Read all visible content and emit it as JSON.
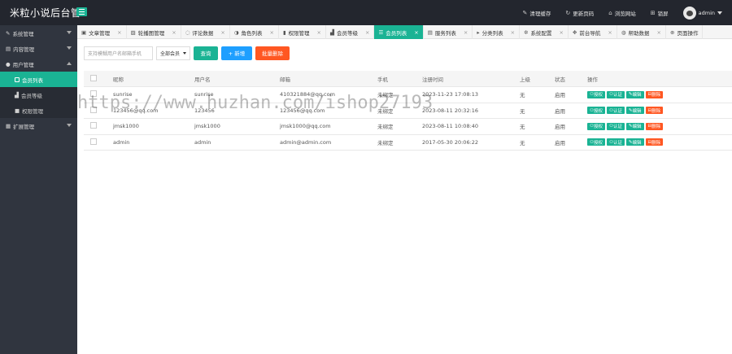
{
  "app": {
    "title": "米粒小说后台管"
  },
  "topnav": [
    {
      "icon": "broom-icon",
      "glyph": "✎",
      "label": "清理缓存"
    },
    {
      "icon": "refresh-icon",
      "glyph": "↻",
      "label": "更新页码"
    },
    {
      "icon": "home-icon",
      "glyph": "⌂",
      "label": "浏览网站"
    },
    {
      "icon": "lock-icon",
      "glyph": "⊞",
      "label": "锁屏"
    },
    {
      "label": "admin"
    }
  ],
  "sidebar": {
    "items": [
      {
        "label": "系统管理"
      },
      {
        "label": "内容管理"
      },
      {
        "label": "用户管理"
      }
    ],
    "subs": [
      {
        "label": "会员列表"
      },
      {
        "label": "会员等级"
      },
      {
        "label": "权限管理"
      }
    ],
    "extra": {
      "label": "扩展管理"
    }
  },
  "tabs": [
    {
      "label": "文章管理"
    },
    {
      "label": "轮播图管理"
    },
    {
      "label": "评论数据"
    },
    {
      "label": "角色列表"
    },
    {
      "label": "权限管理"
    },
    {
      "label": "会员等级"
    },
    {
      "label": "会员列表"
    },
    {
      "label": "服务列表"
    },
    {
      "label": "分类列表"
    },
    {
      "label": "系统配置"
    },
    {
      "label": "前台导航"
    },
    {
      "label": "帮助数据"
    },
    {
      "label": "页面操作"
    }
  ],
  "toolbar": {
    "search_placeholder": "支持模糊用户名邮箱手机",
    "select_value": "全部会员",
    "query_label": "查询",
    "add_label": "+ 新增",
    "batch_delete_label": "批量删除"
  },
  "table": {
    "headers": [
      "",
      "昵称",
      "用户名",
      "邮箱",
      "手机",
      "注册时间",
      "上级",
      "状态",
      "操作"
    ],
    "rows": [
      [
        "sunrise",
        "sunrise",
        "410321884@qq.com",
        "未绑定",
        "2023-11-23 17:08:13",
        "无",
        "启用"
      ],
      [
        "123456@qq.com",
        "123456",
        "123456@qq.com",
        "未绑定",
        "2023-08-11 20:32:16",
        "无",
        "启用"
      ],
      [
        "jmsk1000",
        "jmsk1000",
        "jmsk1000@qq.com",
        "未绑定",
        "2023-08-11 10:08:40",
        "无",
        "启用"
      ],
      [
        "admin",
        "admin",
        "admin@admin.com",
        "未绑定",
        "2017-05-30 20:06:22",
        "无",
        "启用"
      ]
    ],
    "ops": [
      "授权",
      "认证",
      "编辑",
      "删除"
    ]
  },
  "watermark": "https://www.huzhan.com/ishop27193",
  "colors": {
    "topbar": "#23262e",
    "sidebar": "#30353f",
    "accent": "#1ab394",
    "blue": "#1e9fff",
    "orange": "#ff5722"
  }
}
